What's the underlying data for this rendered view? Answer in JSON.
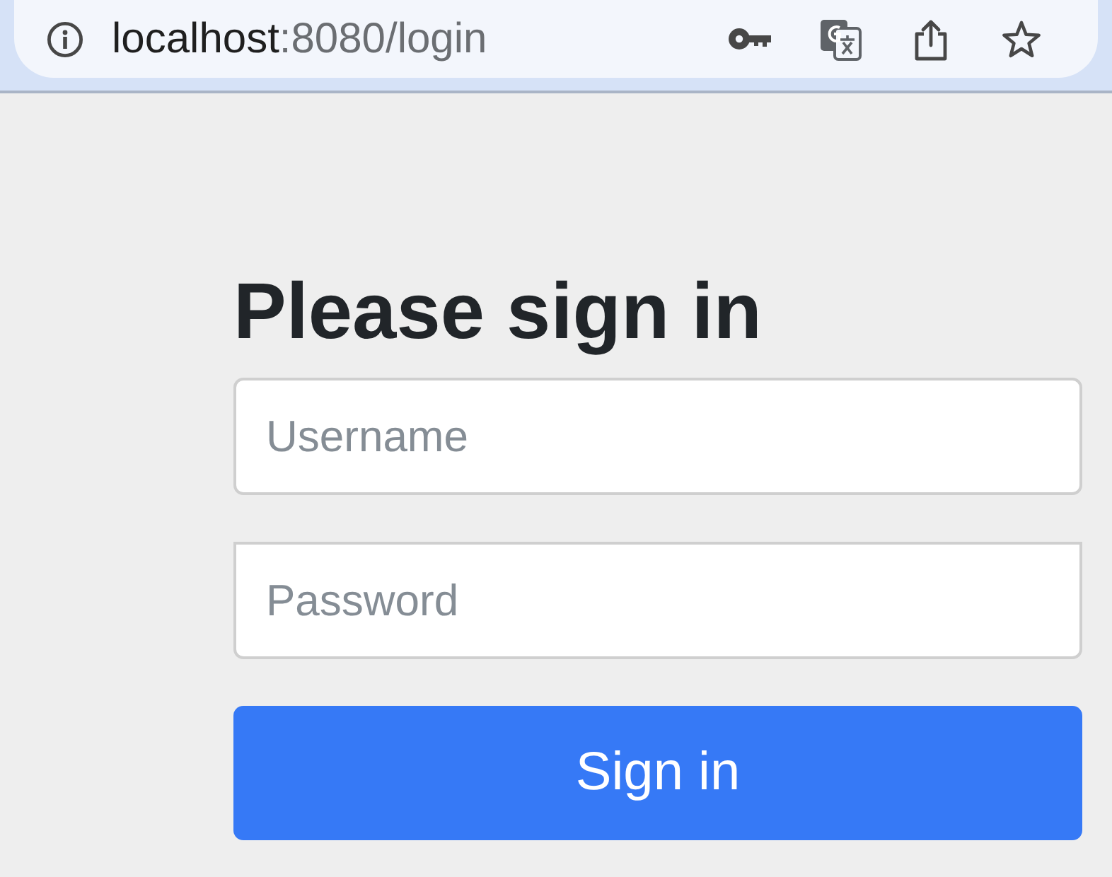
{
  "browser": {
    "url": {
      "host": "localhost",
      "path": ":8080/login"
    }
  },
  "form": {
    "heading": "Please sign in",
    "fields": [
      {
        "placeholder": "Username"
      },
      {
        "placeholder": "Password"
      }
    ],
    "submit": "Sign in"
  }
}
